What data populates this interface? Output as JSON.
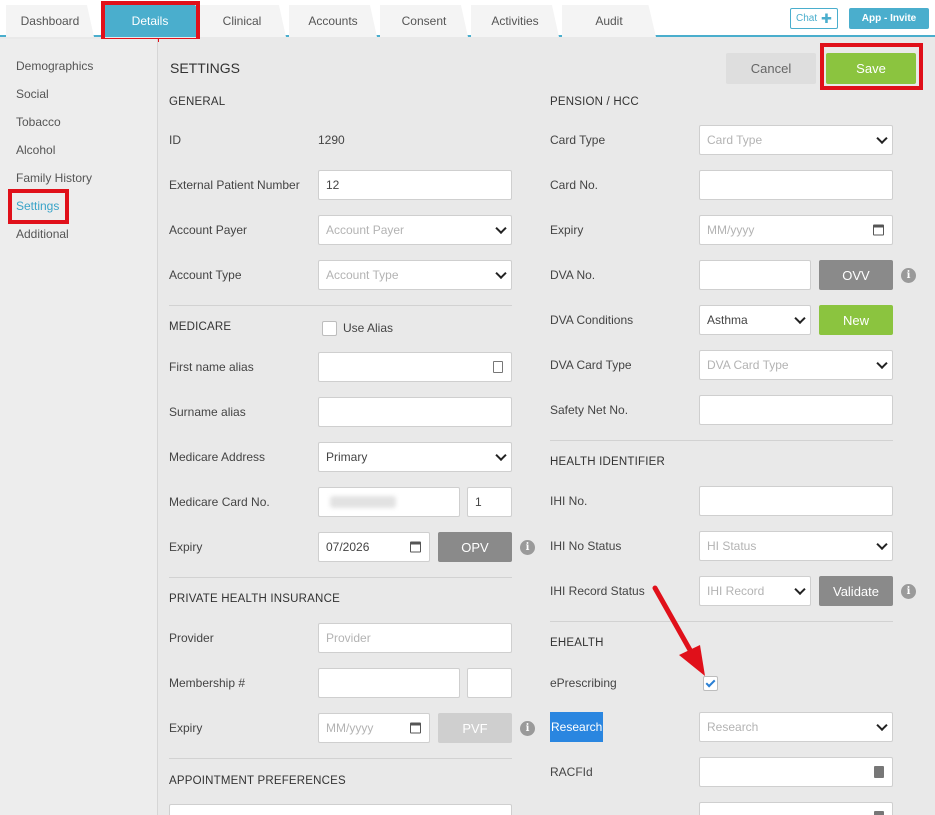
{
  "tabs": [
    {
      "label": "Dashboard"
    },
    {
      "label": "Details"
    },
    {
      "label": "Clinical"
    },
    {
      "label": "Accounts"
    },
    {
      "label": "Consent"
    },
    {
      "label": "Activities"
    },
    {
      "label": "Audit"
    }
  ],
  "top_buttons": {
    "chat": "Chat",
    "app_invite": "App - Invite"
  },
  "sidebar": {
    "items": [
      {
        "label": "Demographics"
      },
      {
        "label": "Social"
      },
      {
        "label": "Tobacco"
      },
      {
        "label": "Alcohol"
      },
      {
        "label": "Family History"
      },
      {
        "label": "Settings"
      },
      {
        "label": "Additional"
      }
    ]
  },
  "main": {
    "title": "SETTINGS",
    "cancel": "Cancel",
    "save": "Save",
    "general": {
      "heading": "GENERAL",
      "id_label": "ID",
      "id_value": "1290",
      "ext_label": "External Patient Number",
      "ext_value": "12",
      "payer_label": "Account Payer",
      "payer_placeholder": "Account Payer",
      "type_label": "Account Type",
      "type_placeholder": "Account Type"
    },
    "medicare": {
      "heading": "MEDICARE",
      "use_alias": "Use Alias",
      "first_alias_label": "First name alias",
      "surname_alias_label": "Surname alias",
      "address_label": "Medicare Address",
      "address_value": "Primary",
      "card_label": "Medicare Card No.",
      "card_irn": "1",
      "expiry_label": "Expiry",
      "expiry_value": "07/2026",
      "opv": "OPV"
    },
    "phi": {
      "heading": "PRIVATE HEALTH INSURANCE",
      "provider_label": "Provider",
      "provider_placeholder": "Provider",
      "membership_label": "Membership #",
      "expiry_label": "Expiry",
      "expiry_placeholder": "MM/yyyy",
      "pvf": "PVF"
    },
    "appointment": {
      "heading": "APPOINTMENT PREFERENCES"
    },
    "pension": {
      "heading": "PENSION / HCC",
      "card_type_label": "Card Type",
      "card_type_placeholder": "Card Type",
      "card_no_label": "Card No.",
      "expiry_label": "Expiry",
      "expiry_placeholder": "MM/yyyy",
      "dva_no_label": "DVA No.",
      "ovv": "OVV",
      "dva_cond_label": "DVA Conditions",
      "dva_cond_value": "Asthma",
      "new": "New",
      "dva_card_type_label": "DVA Card Type",
      "dva_card_type_placeholder": "DVA Card Type",
      "safety_net_label": "Safety Net No."
    },
    "health_identifier": {
      "heading": "HEALTH IDENTIFIER",
      "ihi_label": "IHI No.",
      "ihi_status_label": "IHI No Status",
      "ihi_status_placeholder": "HI Status",
      "ihi_record_label": "IHI Record Status",
      "ihi_record_placeholder": "IHI Record",
      "validate": "Validate"
    },
    "ehealth": {
      "heading": "EHEALTH",
      "eprescribing_label": "ePrescribing",
      "research_label": "Research",
      "research_placeholder": "Research",
      "racfid_label": "RACFId"
    }
  },
  "colors": {
    "accent": "#4aaecd",
    "save": "#8bc43f",
    "highlight": "#e0101a",
    "arrow": "#e0101a"
  },
  "icons": [
    "plus-icon",
    "chevron-down-icon",
    "calendar-icon",
    "info-icon",
    "checkmark-icon",
    "red-arrow-icon"
  ]
}
